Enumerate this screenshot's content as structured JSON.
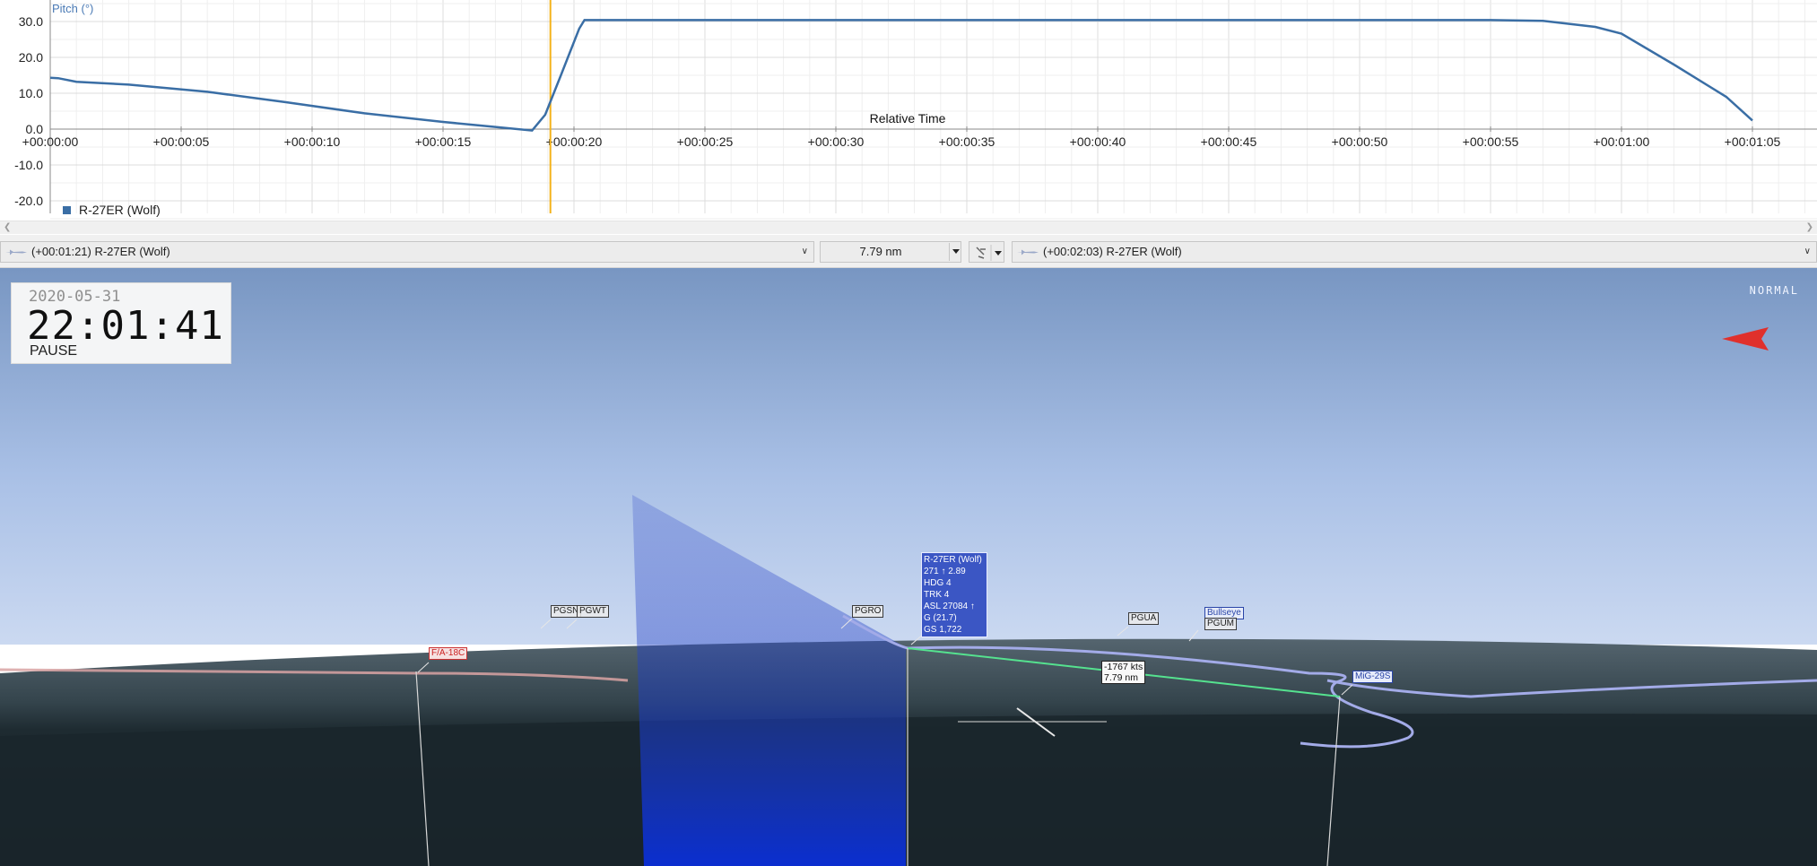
{
  "chart_data": {
    "type": "line",
    "title": "",
    "ylabel": "Pitch (°)",
    "xlabel": "Relative Time",
    "ylim": [
      -20,
      30
    ],
    "xlim": [
      0,
      65
    ],
    "yticks": [
      30,
      20,
      10,
      0,
      -10,
      -20
    ],
    "ytick_labels": [
      "30.0",
      "20.0",
      "10.0",
      "0.0",
      "-10.0",
      "-20.0"
    ],
    "xticks": [
      0,
      5,
      10,
      15,
      20,
      25,
      30,
      35,
      40,
      45,
      50,
      55,
      60,
      65
    ],
    "xtick_labels": [
      "+00:00:00",
      "+00:00:05",
      "+00:00:10",
      "+00:00:15",
      "+00:00:20",
      "+00:00:25",
      "+00:00:30",
      "+00:00:35",
      "+00:00:40",
      "+00:00:45",
      "+00:00:50",
      "+00:00:55",
      "+00:01:00",
      "+00:01:05"
    ],
    "cursor_x": 19.1,
    "grid": true,
    "legend_position": "bottom-left",
    "series": [
      {
        "name": "R-27ER (Wolf)",
        "color": "#3a6ea5",
        "x": [
          0,
          0.3,
          1,
          3,
          6,
          9,
          12,
          15,
          17,
          18.4,
          18.9,
          19.5,
          20.2,
          20.4,
          25,
          35,
          45,
          55,
          57,
          59,
          60,
          62,
          64,
          65
        ],
        "y": [
          14.3,
          14.2,
          13.2,
          12.4,
          10.4,
          7.5,
          4.4,
          2.0,
          0.6,
          -0.4,
          4.0,
          15.0,
          28.0,
          30.4,
          30.4,
          30.4,
          30.4,
          30.4,
          30.2,
          28.5,
          26.6,
          18.0,
          9.0,
          2.4
        ]
      }
    ]
  },
  "toolbar": {
    "left_target": "(+00:01:21) R-27ER (Wolf)",
    "range": "7.79 nm",
    "right_target": "(+00:02:03) R-27ER (Wolf)"
  },
  "clock": {
    "date": "2020-05-31",
    "time": "22:01:41",
    "state": "PAUSE"
  },
  "view_mode": "NORMAL",
  "scene": {
    "labels": {
      "fa18": "F/A-18C",
      "pgsn": "PGSN",
      "pgwt": "PGWT",
      "pgro": "PGRO",
      "pgua": "PGUA",
      "bullseye": "Bullseye",
      "pgum": "PGUM",
      "mig29": "MiG-29S",
      "closure_speed": "-1767 kts",
      "closure_range": "7.79 nm"
    },
    "info_box": {
      "name": "R-27ER (Wolf)",
      "line1": "271 ↑ 2.89",
      "line2": "HDG 4",
      "line3": "TRK 4",
      "line4": "ASL 27084 ↑",
      "line5": "G (21.7)",
      "line6": "GS 1,722"
    },
    "colors": {
      "sky_top": "#7b98c4",
      "sky_bottom": "#c6d5ef",
      "ground": "#1c2a31",
      "missile_trail": "#9fa9e6",
      "friendly_trail": "#d99a9a",
      "los_line": "#4ee08c",
      "radar_cone": "#1f3fc9",
      "compass_arrow": "#e0302c"
    }
  }
}
